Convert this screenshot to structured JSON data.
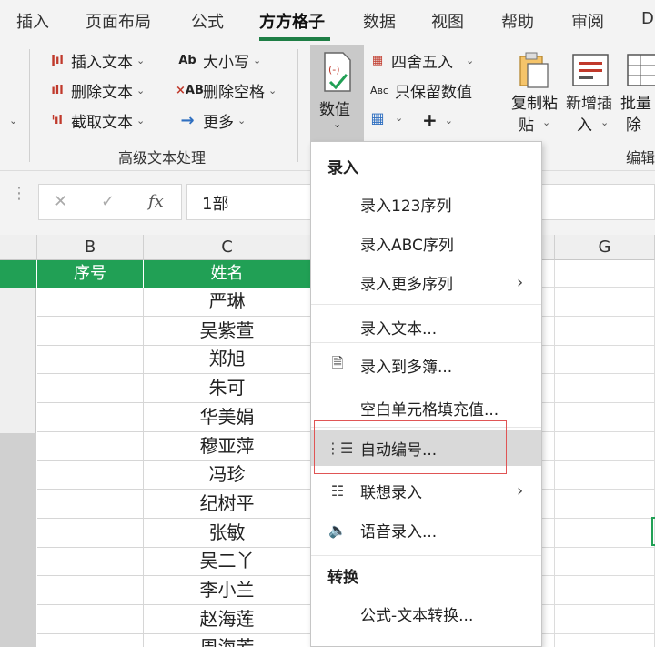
{
  "tabs": [
    {
      "label": "插入"
    },
    {
      "label": "页面布局"
    },
    {
      "label": "公式"
    },
    {
      "label": "方方格子",
      "active": true
    },
    {
      "label": "数据"
    },
    {
      "label": "视图"
    },
    {
      "label": "帮助"
    },
    {
      "label": "审阅"
    },
    {
      "label": "D"
    }
  ],
  "ribbon": {
    "text_group": {
      "insert_text": "插入文本",
      "delete_text": "删除文本",
      "extract_text": "截取文本",
      "case": "大小写",
      "delete_spaces": "删除空格",
      "more": "更多",
      "group_label": "高级文本处理"
    },
    "value_button": "数值",
    "round": "四舍五入",
    "keep_value": "只保留数值",
    "copy_paste": [
      "复制粘",
      "贴"
    ],
    "add_insert": [
      "新增插",
      "入"
    ],
    "batch_delete": [
      "批量",
      "除"
    ],
    "edit_group_label": "编辑"
  },
  "formula_bar": {
    "value": "1部"
  },
  "sheet": {
    "col_headers": [
      "B",
      "C",
      "G"
    ],
    "table_headers": [
      "序号",
      "姓名"
    ],
    "names": [
      "严琳",
      "吴紫萱",
      "郑旭",
      "朱可",
      "华美娟",
      "穆亚萍",
      "冯珍",
      "纪树平",
      "张敏",
      "吴二丫",
      "李小兰",
      "赵海莲",
      "周海芳"
    ]
  },
  "dropdown": {
    "section_input": "录入",
    "items_input": [
      {
        "label": "录入123序列",
        "icon": "",
        "submenu": false
      },
      {
        "label": "录入ABC序列",
        "icon": "",
        "submenu": false
      },
      {
        "label": "录入更多序列",
        "icon": "",
        "submenu": true
      },
      {
        "label": "录入文本...",
        "icon": "",
        "submenu": false
      },
      {
        "label": "录入到多簿...",
        "icon": "document-icon",
        "submenu": false
      },
      {
        "label": "空白单元格填充值...",
        "icon": "",
        "submenu": false
      },
      {
        "label": "自动编号...",
        "icon": "numbered-list-icon",
        "submenu": false,
        "highlighted": true
      },
      {
        "label": "联想录入",
        "icon": "list-icon",
        "submenu": true
      },
      {
        "label": "语音录入...",
        "icon": "speaker-icon",
        "submenu": false
      }
    ],
    "section_convert": "转换",
    "items_convert": [
      {
        "label": "公式-文本转换...",
        "icon": "",
        "submenu": false
      }
    ]
  },
  "colors": {
    "accent_green": "#21a055",
    "tab_underline": "#1e7e45",
    "highlight_box": "#e05555"
  }
}
